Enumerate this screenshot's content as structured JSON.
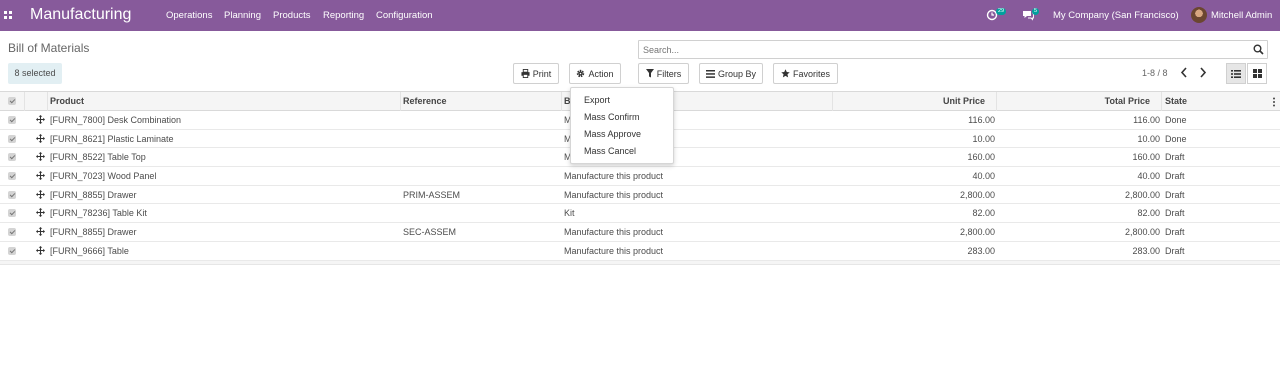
{
  "app": {
    "title": "Manufacturing"
  },
  "nav": {
    "menus": [
      {
        "label": "Operations"
      },
      {
        "label": "Planning"
      },
      {
        "label": "Products"
      },
      {
        "label": "Reporting"
      },
      {
        "label": "Configuration"
      }
    ],
    "activity_count": "29",
    "message_count": "5",
    "company": "My Company (San Francisco)",
    "user": "Mitchell Admin"
  },
  "breadcrumb": {
    "title": "Bill of Materials"
  },
  "selection": {
    "label": "8 selected"
  },
  "toolbar": {
    "print_label": "Print",
    "action_label": "Action",
    "filters_label": "Filters",
    "groupby_label": "Group By",
    "favorites_label": "Favorites"
  },
  "search": {
    "placeholder": "Search...",
    "value": ""
  },
  "pager": {
    "value": "1-8 / 8"
  },
  "action_menu": {
    "items": [
      {
        "label": "Export"
      },
      {
        "label": "Mass Confirm"
      },
      {
        "label": "Mass Approve"
      },
      {
        "label": "Mass Cancel"
      }
    ]
  },
  "table": {
    "columns": {
      "product": "Product",
      "reference": "Reference",
      "bom_type": "B",
      "unit_price": "Unit Price",
      "total_price": "Total Price",
      "state": "State"
    },
    "rows": [
      {
        "product": "[FURN_7800] Desk Combination",
        "reference": "",
        "bom_type": "M",
        "unit_price": "116.00",
        "total_price": "116.00",
        "state": "Done"
      },
      {
        "product": "[FURN_8621] Plastic Laminate",
        "reference": "",
        "bom_type": "M",
        "unit_price": "10.00",
        "total_price": "10.00",
        "state": "Done"
      },
      {
        "product": "[FURN_8522] Table Top",
        "reference": "",
        "bom_type": "M",
        "unit_price": "160.00",
        "total_price": "160.00",
        "state": "Draft"
      },
      {
        "product": "[FURN_7023] Wood Panel",
        "reference": "",
        "bom_type": "Manufacture this product",
        "unit_price": "40.00",
        "total_price": "40.00",
        "state": "Draft"
      },
      {
        "product": "[FURN_8855] Drawer",
        "reference": "PRIM-ASSEM",
        "bom_type": "Manufacture this product",
        "unit_price": "2,800.00",
        "total_price": "2,800.00",
        "state": "Draft"
      },
      {
        "product": "[FURN_78236] Table Kit",
        "reference": "",
        "bom_type": "Kit",
        "unit_price": "82.00",
        "total_price": "82.00",
        "state": "Draft"
      },
      {
        "product": "[FURN_8855] Drawer",
        "reference": "SEC-ASSEM",
        "bom_type": "Manufacture this product",
        "unit_price": "2,800.00",
        "total_price": "2,800.00",
        "state": "Draft"
      },
      {
        "product": "[FURN_9666] Table",
        "reference": "",
        "bom_type": "Manufacture this product",
        "unit_price": "283.00",
        "total_price": "283.00",
        "state": "Draft"
      }
    ]
  },
  "colors": {
    "navbar": "#875a9b",
    "badge": "#00a09d",
    "selected_badge": "#e2eff3"
  }
}
